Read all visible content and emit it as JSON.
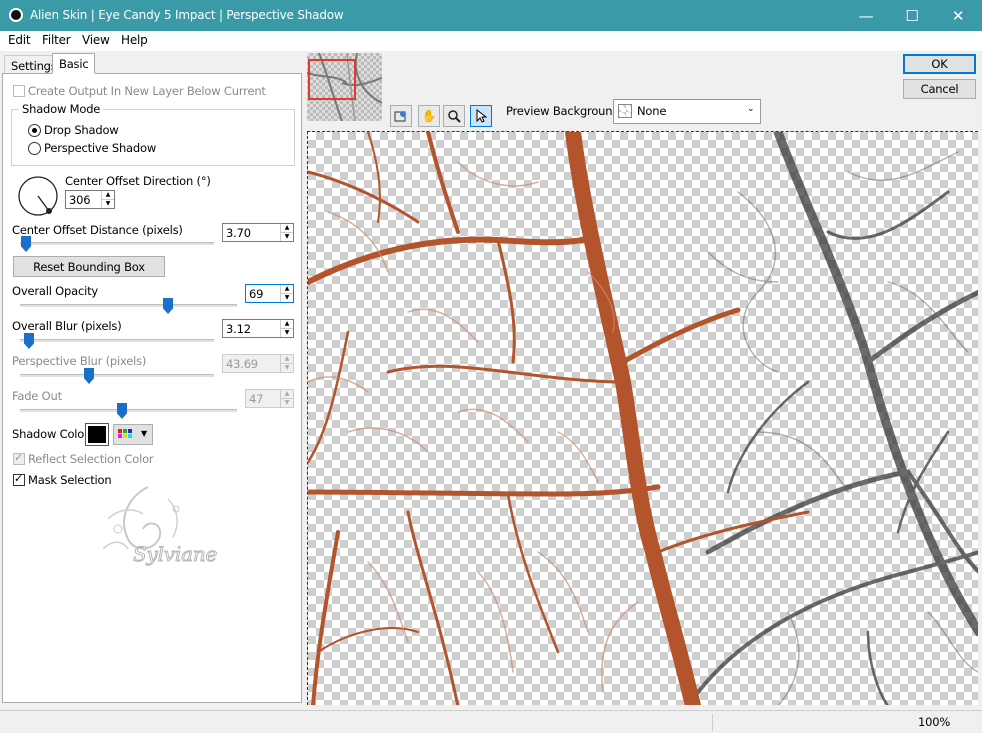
{
  "window": {
    "title": "Alien Skin | Eye Candy 5 Impact | Perspective Shadow"
  },
  "menu": [
    "Edit",
    "Filter",
    "View",
    "Help"
  ],
  "tabs": {
    "settings": "Settings",
    "basic": "Basic"
  },
  "create_output": {
    "label": "Create Output In New Layer Below Current",
    "checked": false,
    "enabled": false
  },
  "shadow_mode": {
    "title": "Shadow Mode",
    "options": [
      "Drop Shadow",
      "Perspective Shadow"
    ],
    "selected": "Drop Shadow"
  },
  "center_offset_direction": {
    "label": "Center Offset Direction (°)",
    "value": "306"
  },
  "center_offset_distance": {
    "label": "Center Offset Distance (pixels)",
    "value": "3.70",
    "slider_fraction": 0.02
  },
  "reset_bbox": {
    "label": "Reset Bounding Box"
  },
  "overall_opacity": {
    "label": "Overall Opacity",
    "value": "69",
    "slider_fraction": 0.69
  },
  "overall_blur": {
    "label": "Overall Blur (pixels)",
    "value": "3.12",
    "slider_fraction": 0.03
  },
  "perspective_blur": {
    "label": "Perspective Blur (pixels)",
    "value": "43.69",
    "slider_fraction": 0.35,
    "enabled": false
  },
  "fade_out": {
    "label": "Fade Out",
    "value": "47",
    "slider_fraction": 0.47,
    "enabled": false
  },
  "shadow_color": {
    "label": "Shadow Color",
    "color": "#000000"
  },
  "reflect_selection": {
    "label": "Reflect Selection Color",
    "checked": true,
    "enabled": false
  },
  "mask_selection": {
    "label": "Mask Selection",
    "checked": true
  },
  "watermark": {
    "text": "Sylviane"
  },
  "toolbar": {
    "preview_bg_label": "Preview Background:",
    "preview_bg_value": "None"
  },
  "buttons": {
    "ok": "OK",
    "cancel": "Cancel"
  },
  "status": {
    "zoom": "100%"
  },
  "colors": {
    "titlebar": "#3a9aa7",
    "slider": "#1a6fc9",
    "branch_copper": "#b4542c",
    "branch_dark": "#3a3a3a"
  }
}
